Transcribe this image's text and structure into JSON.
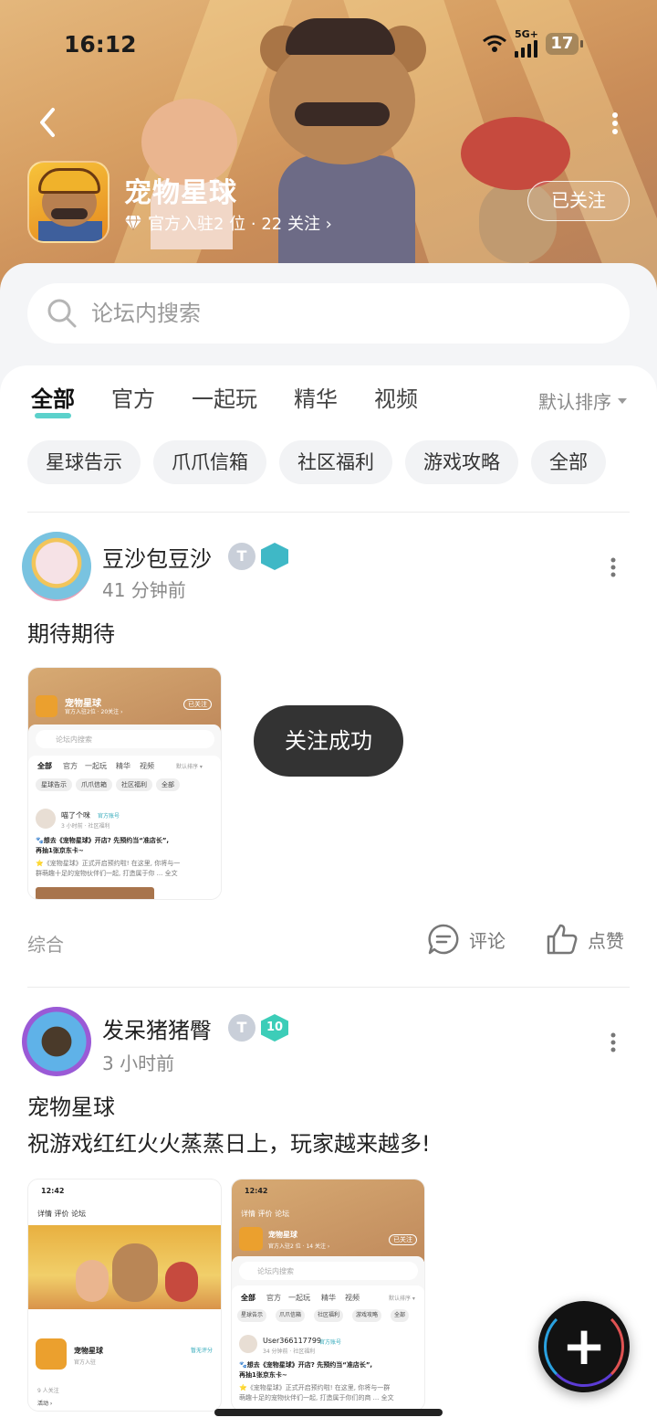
{
  "status": {
    "time": "16:12",
    "network": "5G+",
    "battery": "17"
  },
  "header": {
    "title": "宠物星球",
    "subtitle": "官方入驻2 位 · 22 关注 ›",
    "follow_state": "已关注"
  },
  "search": {
    "placeholder": "论坛内搜索"
  },
  "tabs": [
    {
      "label": "全部",
      "active": true
    },
    {
      "label": "官方"
    },
    {
      "label": "一起玩"
    },
    {
      "label": "精华"
    },
    {
      "label": "视频"
    }
  ],
  "sort": {
    "label": "默认排序"
  },
  "chips": [
    "星球告示",
    "爪爪信箱",
    "社区福利",
    "游戏攻略",
    "全部"
  ],
  "posts": [
    {
      "author": "豆沙包豆沙",
      "time": "41 分钟前",
      "text": "期待期待",
      "tag": "综合",
      "comment_label": "评论",
      "like_label": "点赞",
      "shot": {
        "title": "宠物星球",
        "meta": "官方入驻2位 · 20关注 ›",
        "follow": "已关注",
        "search": "论坛内搜索",
        "tabs": [
          "全部",
          "官方",
          "一起玩",
          "精华",
          "视频"
        ],
        "sort": "默认排序 ▾",
        "chips": [
          "星球告示",
          "爪爪信箱",
          "社区福利",
          "全部"
        ],
        "post_author": "喵了个咪",
        "post_badge": "官方账号",
        "post_time": "3 小时前 · 社区福利",
        "post_title": "🐾想去《宠物星球》开店? 先预约当“准店长”,",
        "post_title2": "再抽1张京东卡~",
        "post_body": "⭐《宠物星球》正式开启预约啦! 在这里, 你将与一",
        "post_body2": "群萌趣十足的宠物伙伴们一起, 打造属于你 ... 全文"
      }
    },
    {
      "author": "发呆猪猪臀",
      "time": "3 小时前",
      "badge_level": "10",
      "text_line1": "宠物星球",
      "text_line2": "祝游戏红红火火蒸蒸日上，玩家越来越多!",
      "shot1": {
        "time": "12:42",
        "tabs": "详情  评价  论坛",
        "app_name": "宠物星球",
        "app_sub": "官方入驻",
        "rate": "暂无评分",
        "fans": "9 人关注",
        "activity": "活动 ›"
      },
      "shot2": {
        "time": "12:42",
        "tabs": "详情  评价  论坛",
        "title": "宠物星球",
        "meta": "官方入驻2 位 · 14 关注 ›",
        "follow": "已关注",
        "search": "论坛内搜索",
        "tabs_row": [
          "全部",
          "官方",
          "一起玩",
          "精华",
          "视频"
        ],
        "sort": "默认排序 ▾",
        "chips": [
          "星球告示",
          "爪爪信箱",
          "社区福利",
          "游戏攻略",
          "全部"
        ],
        "user": "User366117799",
        "user_badge": "官方账号",
        "user_time": "34 分钟前 · 社区福利",
        "post_title": "🐾想去《宠物星球》开店? 先预约当“准店长”,",
        "post_title2": "再抽1张京东卡~",
        "post_body": "⭐《宠物星球》正式开启预约啦! 在这里, 你将与一群",
        "post_body2": "萌趣十足的宠物伙伴们一起, 打造属于你们的商 ... 全文"
      }
    }
  ],
  "toast": "关注成功",
  "colors": {
    "accent": "#33c6be",
    "fab": "#121212"
  }
}
